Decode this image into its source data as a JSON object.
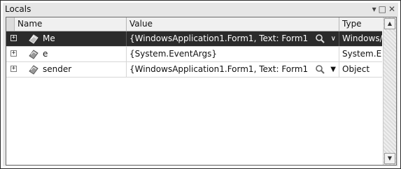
{
  "window": {
    "title": "Locals",
    "icons": [
      "dropdown-icon",
      "maximize-icon",
      "close-icon"
    ]
  },
  "columns": [
    "Name",
    "Value",
    "Type"
  ],
  "rows": [
    {
      "expander": "+",
      "name": "Me",
      "value": "{WindowsApplication1.Form1, Text: Form1",
      "type": "Windows/",
      "selected": true,
      "value_icons": [
        "magnifier-icon",
        "chevron-down-icon"
      ]
    },
    {
      "expander": "+",
      "name": "e",
      "value": "{System.EventArgs}",
      "type": "System.E",
      "selected": false,
      "value_icons": []
    },
    {
      "expander": "+",
      "name": "sender",
      "value": "{WindowsApplication1.Form1, Text: Form1",
      "type": "Object",
      "selected": false,
      "value_icons": [
        "magnifier-icon",
        "dropdown-arrow-icon"
      ]
    }
  ],
  "colors": {
    "selected_row": "#2b2b2b",
    "grid_line": "#d6d6d6"
  }
}
